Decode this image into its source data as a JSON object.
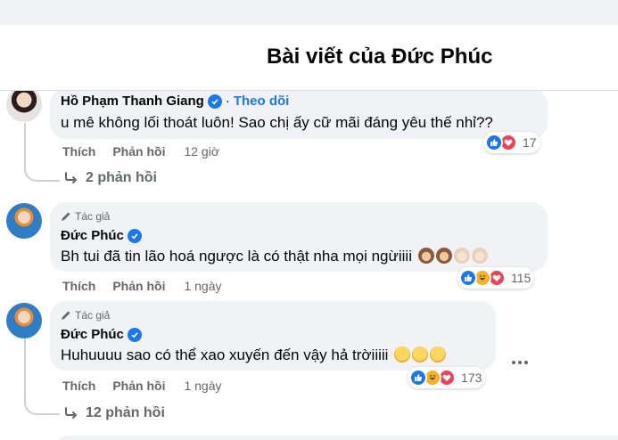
{
  "header": {
    "title": "Bài viết của Đức Phúc"
  },
  "comments": [
    {
      "author": "Hồ Phạm Thanh Giang",
      "follow_label": "Theo dõi",
      "separator": "·",
      "text": "u mê không lối thoát luôn! Sao chị ấy cữ mãi đáng yêu thế nhỉ??",
      "like_label": "Thích",
      "reply_label": "Phản hồi",
      "time": "12 giờ",
      "reaction_count": "17",
      "reaction_icons": [
        "like-icon",
        "love-icon"
      ],
      "replies_label": "2 phản hồi"
    },
    {
      "author_tag": "Tác giả",
      "author": "Đức Phúc",
      "text": "Bh tui đã tin lão hoá ngược là có thật nha mọi ngừiiii",
      "like_label": "Thích",
      "reply_label": "Phản hồi",
      "time": "1 ngày",
      "reaction_count": "115",
      "reaction_icons": [
        "like-icon",
        "haha-icon",
        "love-icon"
      ]
    },
    {
      "author_tag": "Tác giả",
      "author": "Đức Phúc",
      "text": "Huhuuuu sao có thể xao xuyến đến vậy hả trờiiiii",
      "like_label": "Thích",
      "reply_label": "Phản hồi",
      "time": "1 ngày",
      "reaction_count": "173",
      "reaction_icons": [
        "like-icon",
        "haha-icon",
        "love-icon"
      ],
      "replies_label": "12 phản hồi"
    }
  ],
  "colors": {
    "accent": "#1877f2",
    "secondary_text": "#65676b",
    "bubble": "#f0f2f5",
    "love": "#f33e58",
    "haha": "#f7b125"
  }
}
